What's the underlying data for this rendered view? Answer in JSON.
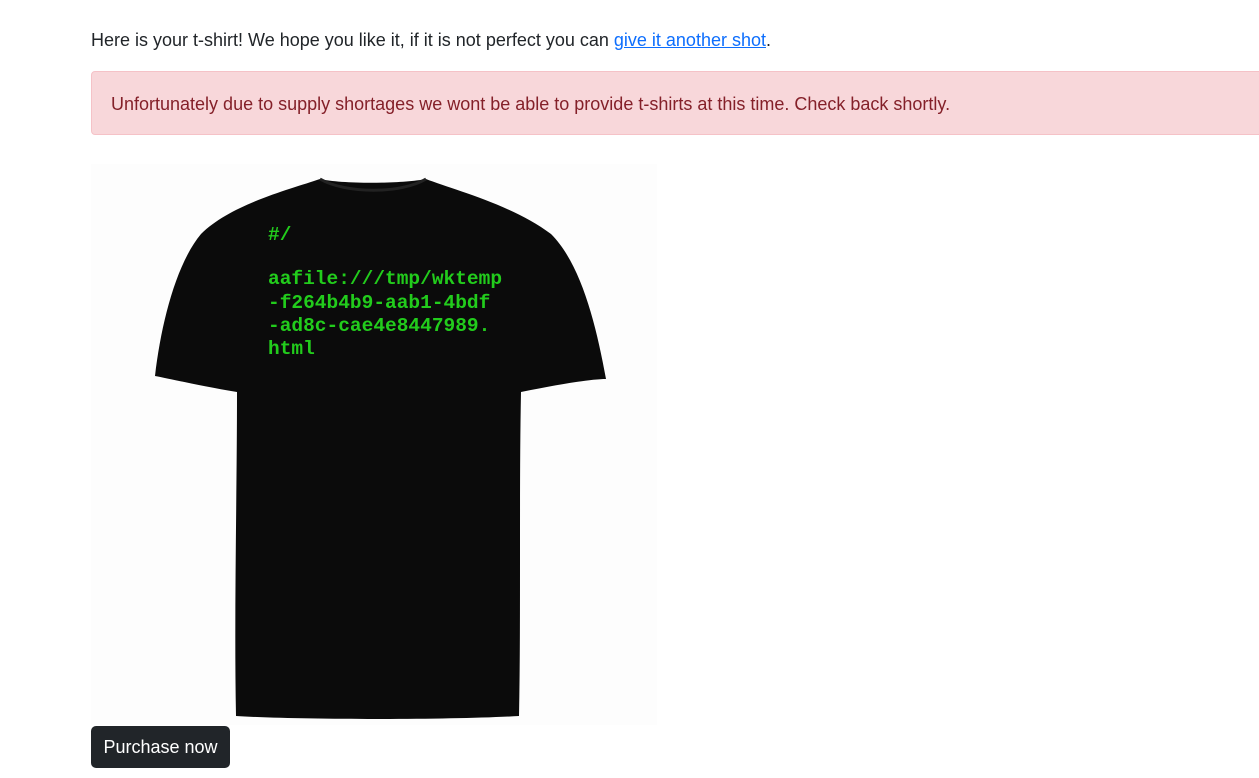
{
  "intro": {
    "text_before": "Here is your t-shirt! We hope you like it, if it is not perfect you can ",
    "link_label": "give it another shot",
    "text_after": "."
  },
  "alert": {
    "message": "Unfortunately due to supply shortages we wont be able to provide t-shirts at this time. Check back shortly."
  },
  "tshirt": {
    "color": "#0a0a0a",
    "text_color": "#22cc1c",
    "print_lines": [
      "#/",
      "aafile:///tmp/wktemp",
      "-f264b4b9-aab1-4bdf",
      "-ad8c-cae4e8447989.",
      "html"
    ]
  },
  "actions": {
    "purchase_label": "Purchase now"
  },
  "colors": {
    "link": "#0d6efd",
    "alert_bg": "#f8d7da",
    "alert_text": "#842029",
    "button_bg": "#212529"
  }
}
